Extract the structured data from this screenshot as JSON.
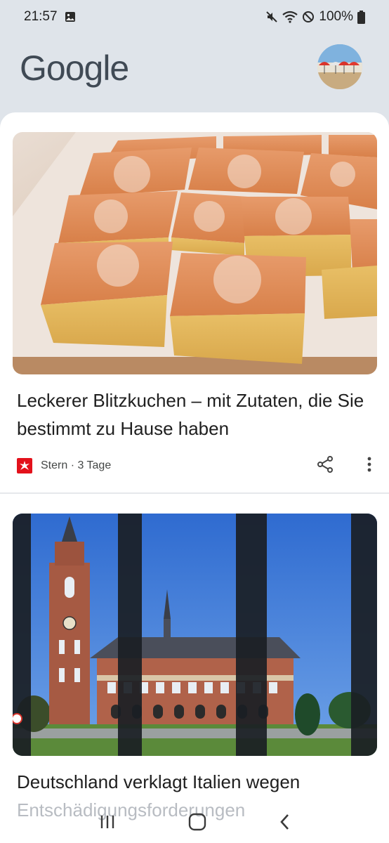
{
  "status_bar": {
    "time": "21:57",
    "battery": "100%",
    "icons": [
      "image-icon",
      "mute-icon",
      "wifi-icon",
      "do-not-disturb-icon",
      "battery-icon"
    ]
  },
  "header": {
    "logo": "Google",
    "avatar": "profile-avatar"
  },
  "feed": {
    "cards": [
      {
        "headline": "Leckerer Blitzkuchen – mit Zutaten, die Sie bestimmt zu Hause haben",
        "source": "Stern",
        "age": "3 Tage",
        "meta": "Stern · 3 Tage",
        "image": "sponge-cake-squares"
      },
      {
        "headline_line1": "Deutschland verklagt Italien wegen",
        "headline_line2": "Entschädigungsforderungen",
        "image": "peace-palace-behind-bars"
      }
    ]
  },
  "navbar": {
    "icons": [
      "recent-apps-icon",
      "home-icon",
      "back-icon"
    ]
  },
  "colors": {
    "background": "#dfe4ea",
    "card": "#ffffff",
    "stern_red": "#e3111b",
    "text": "#1f1f1f"
  }
}
